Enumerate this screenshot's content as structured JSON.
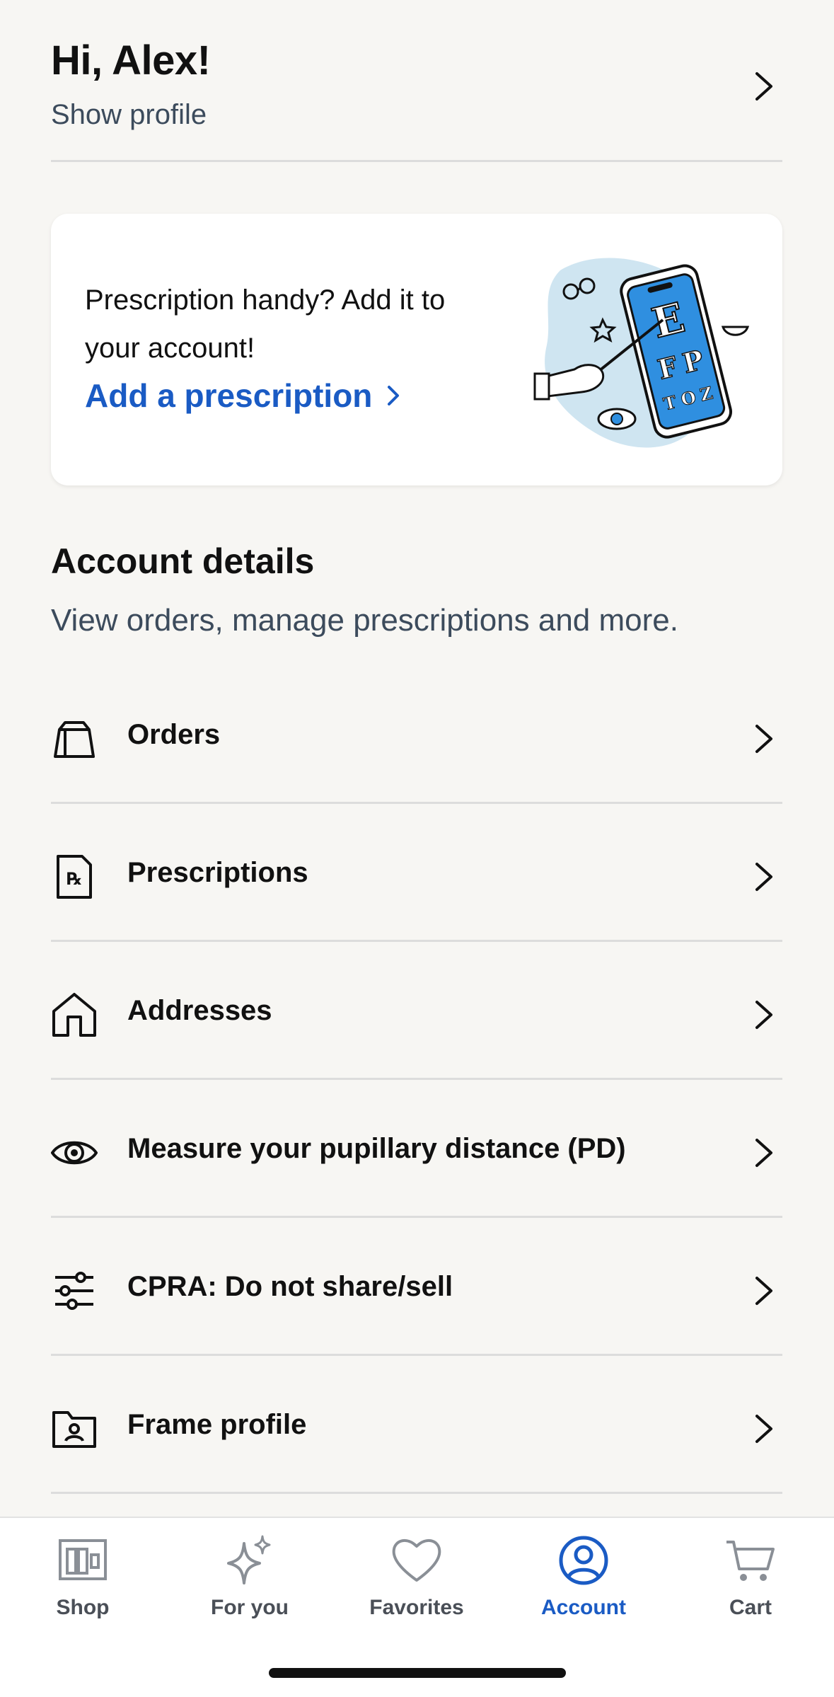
{
  "header": {
    "greeting": "Hi, Alex!",
    "subtitle": "Show profile"
  },
  "promo": {
    "text": "Prescription handy? Add it to your account!",
    "link_label": "Add a prescription",
    "illustration_letters": [
      "E",
      "F",
      "P",
      "T",
      "O",
      "Z"
    ]
  },
  "account": {
    "title": "Account details",
    "subtitle": "View orders, manage prescriptions and more.",
    "items": [
      {
        "label": "Orders",
        "icon": "shopping-bag-icon"
      },
      {
        "label": "Prescriptions",
        "icon": "prescription-icon"
      },
      {
        "label": "Addresses",
        "icon": "house-icon"
      },
      {
        "label": "Measure your pupillary distance (PD)",
        "icon": "eye-icon"
      },
      {
        "label": "CPRA: Do not share/sell",
        "icon": "sliders-icon"
      },
      {
        "label": "Frame profile",
        "icon": "frame-profile-icon"
      }
    ]
  },
  "nav": {
    "active_color": "#1a5bc4",
    "tabs": [
      {
        "label": "Shop",
        "icon": "shop-icon"
      },
      {
        "label": "For you",
        "icon": "sparkles-icon"
      },
      {
        "label": "Favorites",
        "icon": "heart-icon"
      },
      {
        "label": "Account",
        "icon": "account-icon",
        "active": true
      },
      {
        "label": "Cart",
        "icon": "cart-icon"
      }
    ]
  }
}
